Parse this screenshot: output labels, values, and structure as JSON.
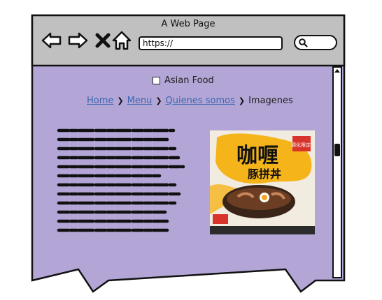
{
  "window": {
    "title": "A Web Page"
  },
  "toolbar": {
    "url": "https://"
  },
  "page": {
    "checkbox_label": "Asian Food",
    "breadcrumb": {
      "items": [
        "Home",
        "Menu",
        "Quienes somos"
      ],
      "current": "Imagenes"
    },
    "image": {
      "text_main": "咖喱",
      "text_sub": "豚拼丼",
      "corner": "週化限定"
    }
  },
  "colors": {
    "chrome": "#c0c0c0",
    "page_bg": "#b3a6d6",
    "link": "#3a66b0",
    "image_yellow": "#f4b41a"
  }
}
